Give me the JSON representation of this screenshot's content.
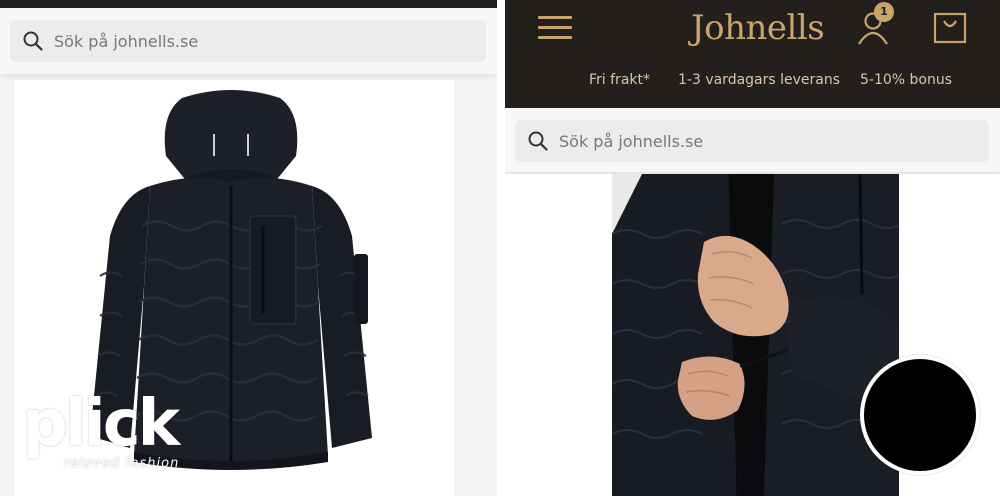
{
  "left": {
    "search": {
      "placeholder": "Sök på johnells.se"
    }
  },
  "right": {
    "header": {
      "brand": "Johnells",
      "cart_badge": "1",
      "usps": [
        "Fri frakt*",
        "1-3 vardagars leverans",
        "5-10% bonus"
      ]
    },
    "search": {
      "placeholder": "Sök på johnells.se"
    }
  },
  "watermark": {
    "word": "plick",
    "tagline": "reloved fashion"
  },
  "colors": {
    "header_bg": "#231f1d",
    "accent_gold": "#c9a56a",
    "jacket": "#1b1e27"
  },
  "icons": [
    "search-icon",
    "menu-icon",
    "user-icon",
    "shopping-bag-icon"
  ]
}
